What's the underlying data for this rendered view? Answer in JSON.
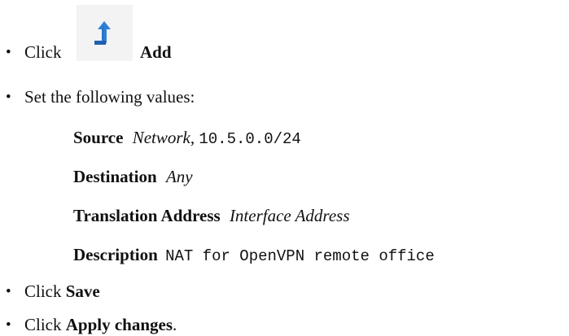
{
  "steps": [
    {
      "prefix": "Click",
      "label": "Add",
      "icon": "add-arrow-up-icon"
    },
    {
      "text": "Set the following values:"
    },
    {
      "prefix": "Click",
      "label": "Save"
    },
    {
      "prefix": "Click",
      "label": "Apply changes",
      "suffix": "."
    }
  ],
  "fields": {
    "source": {
      "label": "Source",
      "type": "Network",
      "sep": ",",
      "value": "10.5.0.0/24"
    },
    "destination": {
      "label": "Destination",
      "value": "Any"
    },
    "translation": {
      "label": "Translation Address",
      "value": "Interface Address"
    },
    "description": {
      "label": "Description",
      "value": "NAT for OpenVPN remote office"
    }
  },
  "colors": {
    "icon_blue": "#2f80d8",
    "icon_dark": "#1f5fae",
    "icon_bg": "#f3f3f3"
  }
}
